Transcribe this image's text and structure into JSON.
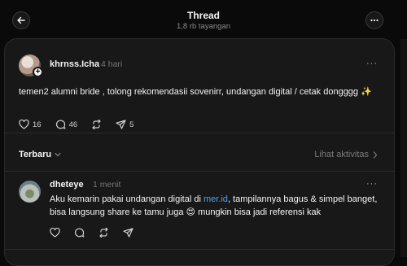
{
  "header": {
    "title": "Thread",
    "views": "1,8 rb tayangan",
    "back_icon": "arrow-left-icon",
    "more_icon": "more-horizontal-icon"
  },
  "post": {
    "username": "khrnss.Icha",
    "time": "4 hari",
    "text": "temen2 alumni bride , tolong rekomendasii sovenirr, undangan digital / cetak dongggg ✨",
    "likes": "16",
    "comments": "46",
    "shares": "5",
    "more": "···"
  },
  "replies_header": {
    "sort_label": "Terbaru",
    "activity_label": "Lihat aktivitas"
  },
  "reply": {
    "username": "dheteye",
    "time": "1 menit",
    "text_before": "Aku kemarin pakai undangan digital di ",
    "link": "mer.id",
    "text_after": ", tampilannya bagus & simpel banget, bisa langsung share ke tamu juga 😍 mungkin bisa jadi referensi kak",
    "more": "···"
  },
  "colors": {
    "background": "#0a0a0a",
    "card": "#181818",
    "link": "#4ea1f3",
    "muted": "#777777"
  }
}
